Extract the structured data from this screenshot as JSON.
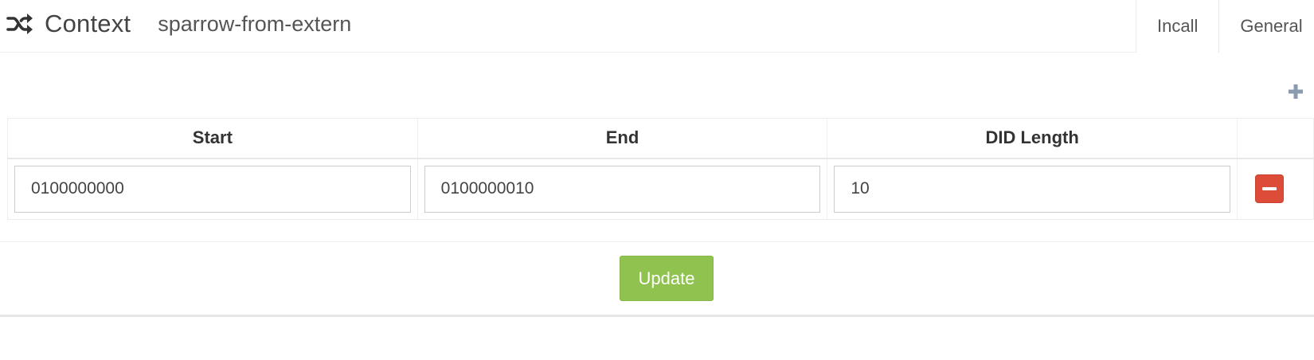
{
  "header": {
    "icon": "shuffle-icon",
    "title": "Context",
    "context_name": "sparrow-from-extern"
  },
  "tabs": [
    {
      "label": "Incall",
      "active": true
    },
    {
      "label": "General",
      "active": false
    }
  ],
  "toolbar": {
    "add_icon": "plus-icon"
  },
  "table": {
    "columns": [
      "Start",
      "End",
      "DID Length"
    ],
    "rows": [
      {
        "start": "0100000000",
        "end": "0100000010",
        "did_length": "10",
        "remove_icon": "minus-icon"
      }
    ]
  },
  "actions": {
    "update_label": "Update"
  },
  "colors": {
    "remove": "#dd4b39",
    "update": "#8fc24f"
  }
}
